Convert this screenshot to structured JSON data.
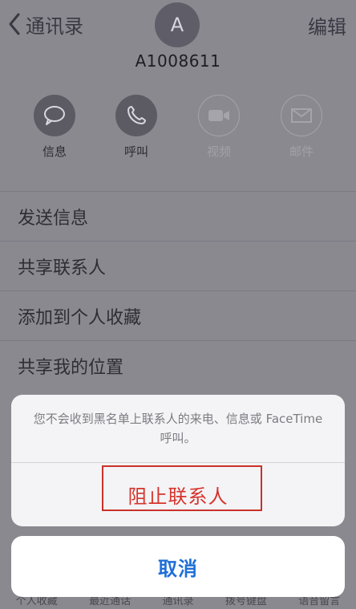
{
  "nav": {
    "back_label": "通讯录",
    "edit_label": "编辑"
  },
  "contact": {
    "avatar_initial": "A",
    "name": "A1008611"
  },
  "actions": [
    {
      "label": "信息",
      "icon": "message-icon",
      "enabled": true
    },
    {
      "label": "呼叫",
      "icon": "phone-icon",
      "enabled": true
    },
    {
      "label": "视频",
      "icon": "video-icon",
      "enabled": false
    },
    {
      "label": "邮件",
      "icon": "mail-icon",
      "enabled": false
    }
  ],
  "menu": [
    "发送信息",
    "共享联系人",
    "添加到个人收藏",
    "共享我的位置"
  ],
  "tabbar": [
    "个人收藏",
    "最近通话",
    "通讯录",
    "拨号键盘",
    "语音留言"
  ],
  "sheet": {
    "message": "您不会收到黑名单上联系人的来电、信息或 FaceTime 呼叫。",
    "block_label": "阻止联系人",
    "cancel_label": "取消"
  },
  "colors": {
    "destructive": "#d6342c",
    "accent": "#1f6fd8",
    "highlight": "#c9312b"
  }
}
